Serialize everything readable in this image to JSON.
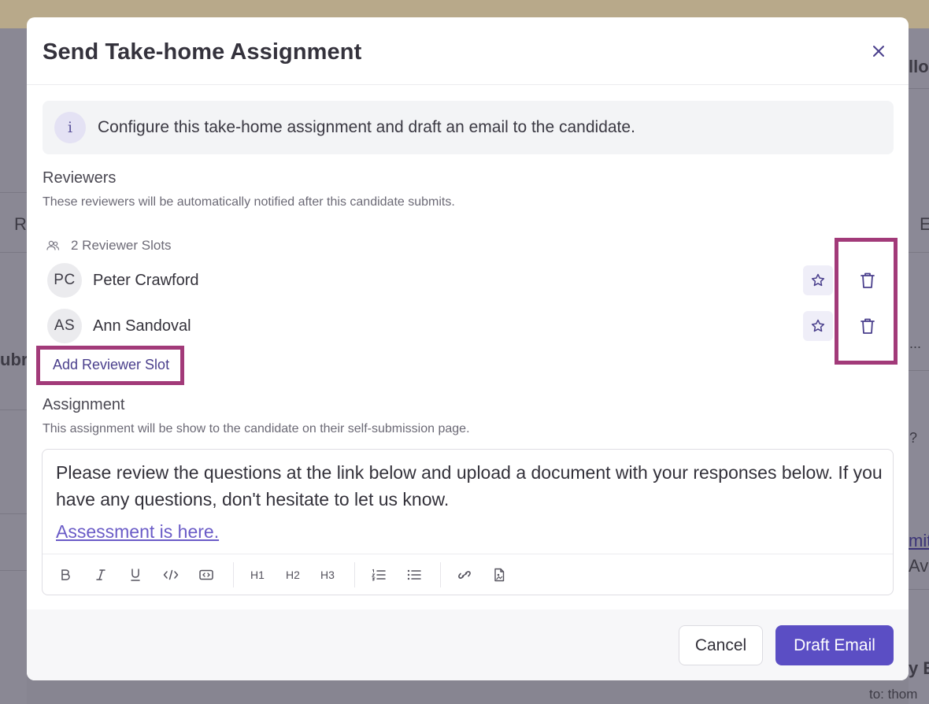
{
  "background": {
    "left_fragments": [
      "Re",
      "ubr"
    ],
    "right_fragments": [
      "llov",
      "E",
      "...",
      "?",
      "mit",
      "Ave",
      "y E",
      "to: thom"
    ]
  },
  "modal": {
    "title": "Send Take-home Assignment",
    "info_text": "Configure this take-home assignment and draft an email to the candidate.",
    "reviewers": {
      "label": "Reviewers",
      "help": "These reviewers will be automatically notified after this candidate submits.",
      "slots_text": "2 Reviewer Slots",
      "items": [
        {
          "initials": "PC",
          "name": "Peter Crawford"
        },
        {
          "initials": "AS",
          "name": "Ann Sandoval"
        }
      ],
      "add_slot_label": "Add Reviewer Slot"
    },
    "assignment": {
      "label": "Assignment",
      "help": "This assignment will be show to the candidate on their self-submission page.",
      "body": "Please review the questions at the link below and upload a document with your responses below. If you have any questions, don't hesitate to let us know.",
      "link_text": "Assessment is here.",
      "toolbar": {
        "h1": "H1",
        "h2": "H2",
        "h3": "H3"
      }
    },
    "footer": {
      "cancel_label": "Cancel",
      "draft_label": "Draft Email"
    }
  },
  "colors": {
    "accent": "#5b4ec4",
    "highlight": "#a23a79",
    "link": "#6a5bc7"
  }
}
